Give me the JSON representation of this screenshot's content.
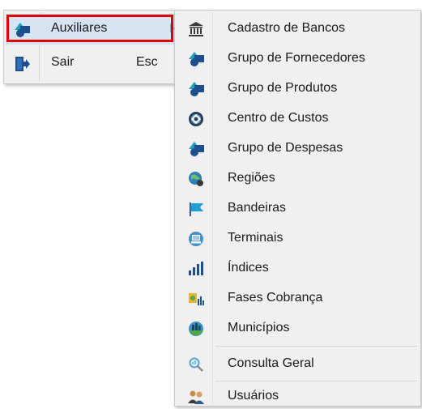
{
  "main_menu": {
    "items": [
      {
        "label": "Auxiliares",
        "icon": "shapes-icon",
        "shortcut": ""
      },
      {
        "label": "Sair",
        "icon": "exit-door-icon",
        "shortcut": "Esc"
      }
    ]
  },
  "submenu": {
    "items": [
      {
        "label": "Cadastro de Bancos",
        "icon": "bank-icon"
      },
      {
        "label": "Grupo de Fornecedores",
        "icon": "shapes-icon"
      },
      {
        "label": "Grupo de Produtos",
        "icon": "shapes-icon"
      },
      {
        "label": "Centro de Custos",
        "icon": "gear-disc-icon"
      },
      {
        "label": "Grupo de Despesas",
        "icon": "shapes-icon"
      },
      {
        "label": "Regiões",
        "icon": "globe-icon"
      },
      {
        "label": "Bandeiras",
        "icon": "flag-icon"
      },
      {
        "label": "Terminais",
        "icon": "terminal-icon"
      },
      {
        "label": "Índices",
        "icon": "bar-chart-icon"
      },
      {
        "label": "Fases Cobrança",
        "icon": "charge-phases-icon"
      },
      {
        "label": "Municípios",
        "icon": "city-globe-icon"
      },
      {
        "label": "Consulta Geral",
        "icon": "magnifier-icon"
      },
      {
        "label": "Usuários",
        "icon": "users-icon"
      }
    ]
  },
  "colors": {
    "highlight": "#d5e3f2",
    "focus_border": "#e00000",
    "icon_blue": "#1e4f8c",
    "icon_teal": "#1f9fbf"
  }
}
